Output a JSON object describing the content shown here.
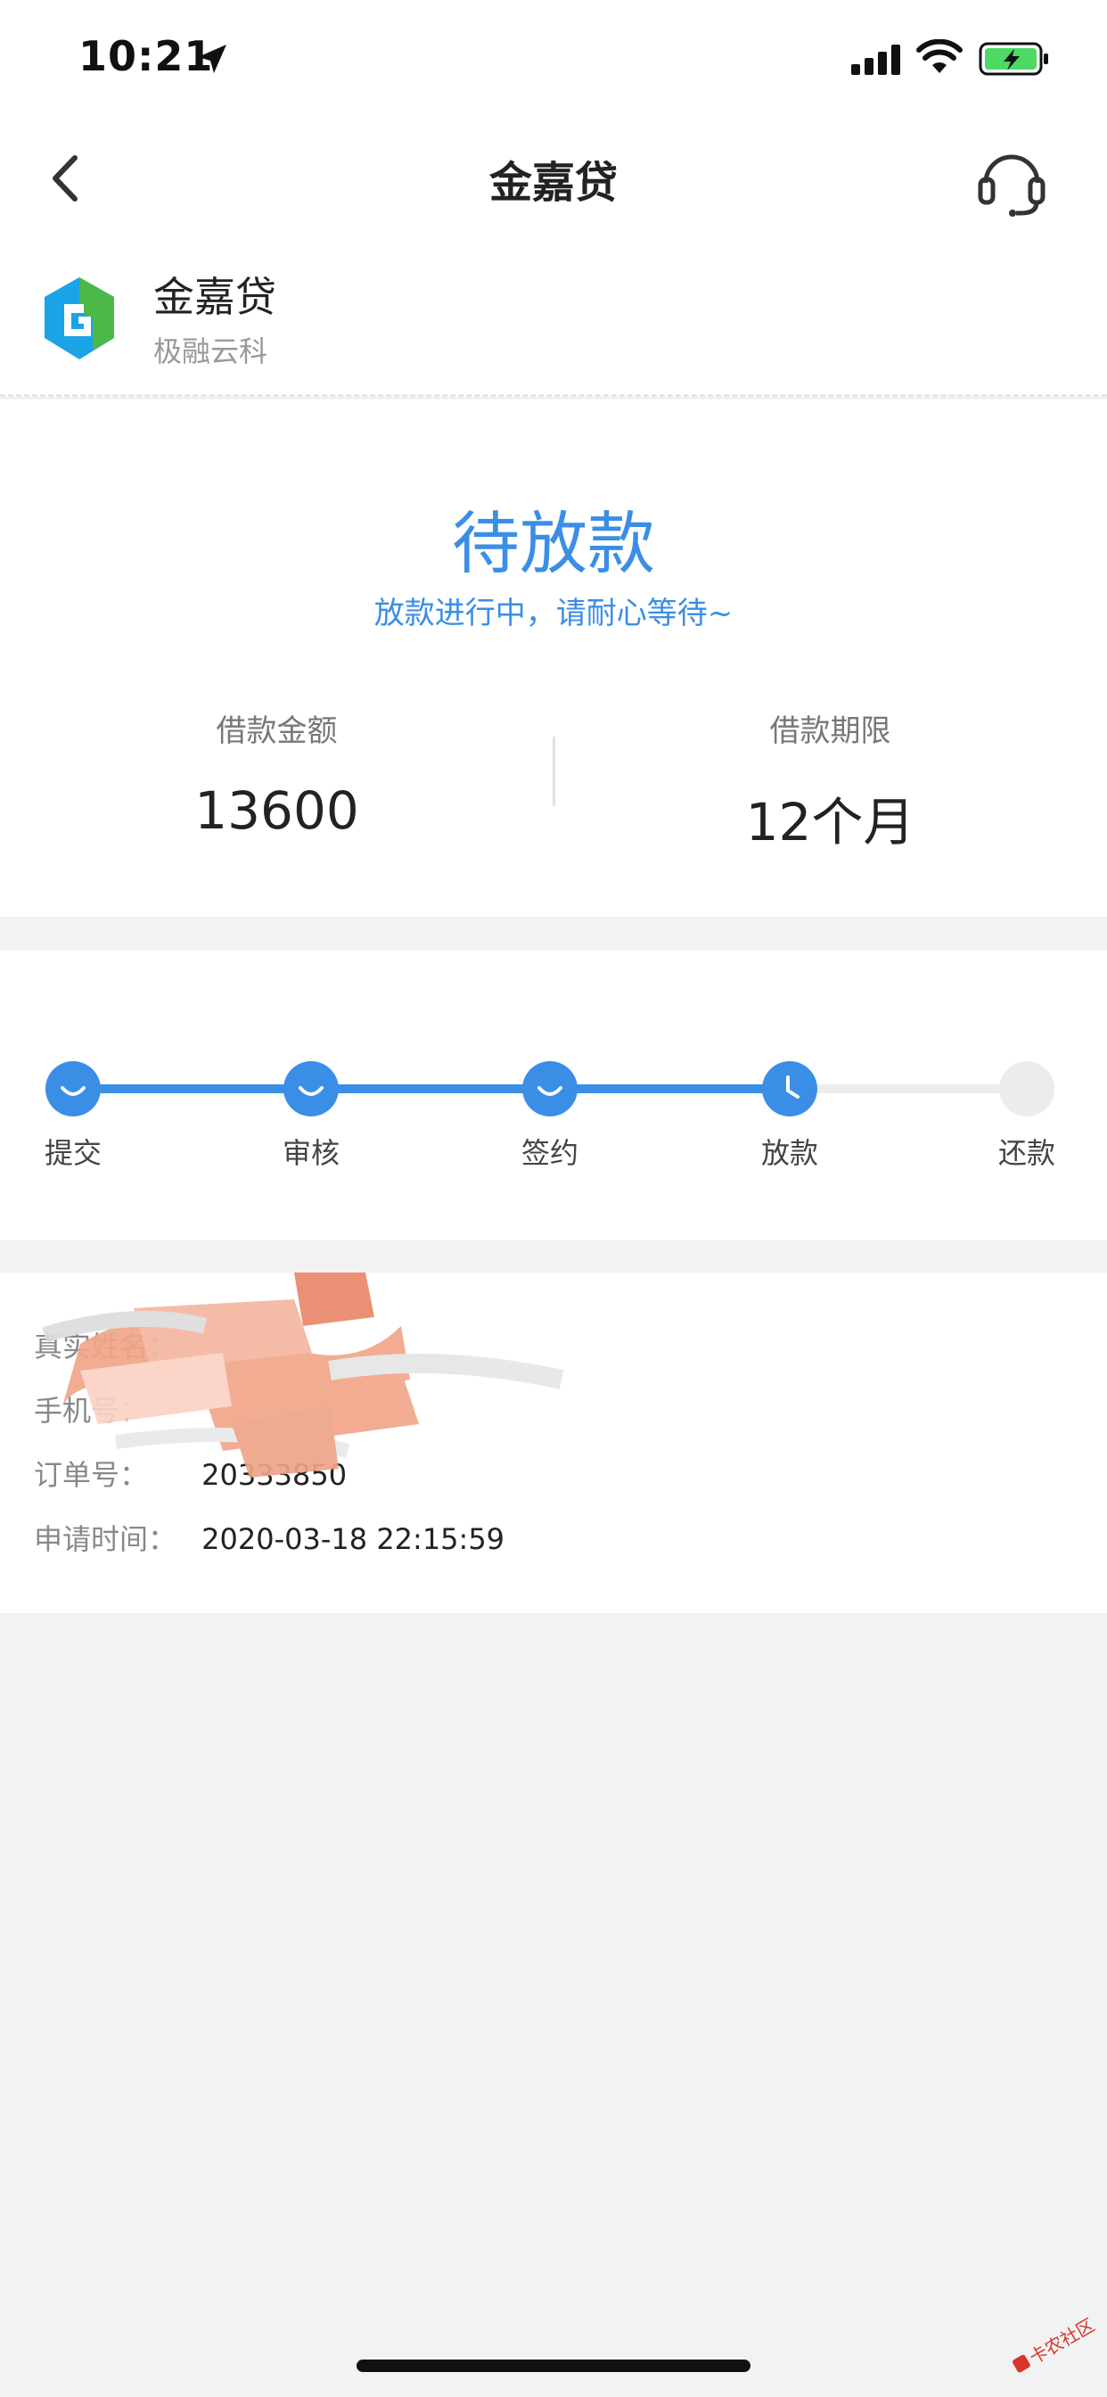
{
  "status_bar": {
    "time": "10:21"
  },
  "nav": {
    "title": "金嘉贷"
  },
  "product": {
    "name": "金嘉贷",
    "company": "极融云科"
  },
  "status": {
    "title": "待放款",
    "subtitle": "放款进行中，请耐心等待~",
    "amount_label": "借款金额",
    "amount_value": "13600",
    "term_label": "借款期限",
    "term_value": "12个月"
  },
  "progress": {
    "steps": [
      {
        "label": "提交",
        "state": "done"
      },
      {
        "label": "审核",
        "state": "done"
      },
      {
        "label": "签约",
        "state": "done"
      },
      {
        "label": "放款",
        "state": "current"
      },
      {
        "label": "还款",
        "state": "pending"
      }
    ]
  },
  "info": {
    "rows": [
      {
        "label": "真实姓名：",
        "value": ""
      },
      {
        "label": "手机号：",
        "value": ""
      },
      {
        "label": "订单号：",
        "value": "20333850"
      },
      {
        "label": "申请时间：",
        "value": "2020-03-18 22:15:59"
      }
    ]
  },
  "watermark": {
    "text": "卡农社区"
  },
  "colors": {
    "accent": "#3a8ee6",
    "background": "#f2f2f2",
    "card": "#ffffff"
  }
}
